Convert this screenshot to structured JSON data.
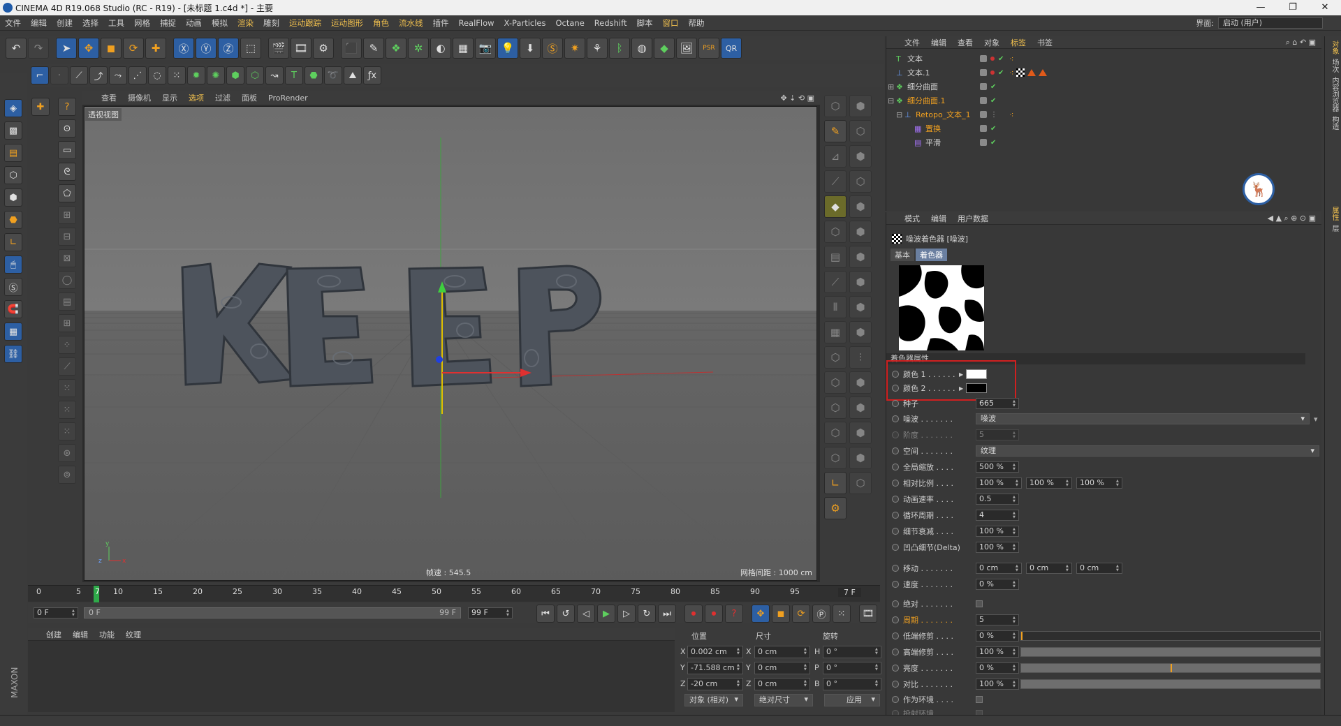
{
  "titlebar": {
    "title": "CINEMA 4D R19.068 Studio (RC - R19) - [未标题 1.c4d *] - 主要",
    "minimize": "—",
    "maximize": "❐",
    "close": "✕"
  },
  "menubar": {
    "items": [
      "文件",
      "编辑",
      "创建",
      "选择",
      "工具",
      "网格",
      "捕捉",
      "动画",
      "模拟",
      "渲染",
      "雕刻",
      "运动跟踪",
      "运动图形",
      "角色",
      "流水线",
      "插件",
      "RealFlow",
      "X-Particles",
      "Octane",
      "Redshift",
      "脚本",
      "窗口",
      "帮助"
    ],
    "layout_label": "界面:",
    "layout_value": "启动 (用户)"
  },
  "viewport": {
    "menu": [
      "查看",
      "摄像机",
      "显示",
      "选项",
      "过滤",
      "面板",
      "ProRender"
    ],
    "label": "透视视图",
    "fps": "帧速 : 545.5",
    "grid": "网格间距 : 1000 cm",
    "scene_text": "KEEP"
  },
  "timeline": {
    "ticks": [
      "0",
      "5",
      "7",
      "10",
      "15",
      "20",
      "25",
      "30",
      "35",
      "40",
      "45",
      "50",
      "55",
      "60",
      "65",
      "70",
      "75",
      "80",
      "85",
      "90",
      "95"
    ],
    "current_frame": "7 F",
    "start": "0 F",
    "range_start": "0 F",
    "range_end": "99 F",
    "end": "99 F"
  },
  "material_manager": {
    "menu": [
      "创建",
      "编辑",
      "功能",
      "纹理"
    ]
  },
  "coords": {
    "headers": [
      "位置",
      "尺寸",
      "旋转"
    ],
    "x_pos": "0.002 cm",
    "y_pos": "-71.588 cm",
    "z_pos": "-20 cm",
    "x_size": "0 cm",
    "y_size": "0 cm",
    "z_size": "0 cm",
    "h_rot": "0 °",
    "p_rot": "0 °",
    "b_rot": "0 °",
    "axis_x": "X",
    "axis_y": "Y",
    "axis_z": "Z",
    "axis_h": "H",
    "axis_p": "P",
    "axis_b": "B",
    "mode_obj": "对象 (相对)",
    "mode_size": "绝对尺寸",
    "apply": "应用"
  },
  "object_manager": {
    "menu": [
      "文件",
      "编辑",
      "查看",
      "对象",
      "标签",
      "书签"
    ],
    "objects": [
      {
        "name": "文本",
        "color": "#d0d0d0"
      },
      {
        "name": "文本.1",
        "color": "#d0d0d0"
      },
      {
        "name": "细分曲面",
        "color": "#d0d0d0"
      },
      {
        "name": "细分曲面.1",
        "color": "#f0a020"
      },
      {
        "name": "Retopo_文本_1",
        "color": "#f0a020"
      },
      {
        "name": "置换",
        "color": "#f0a020"
      },
      {
        "name": "平滑",
        "color": "#d0d0d0"
      }
    ]
  },
  "attribute_manager": {
    "menu": [
      "模式",
      "编辑",
      "用户数据"
    ],
    "title": "噪波着色器 [噪波]",
    "tabs": [
      "基本",
      "着色器"
    ],
    "section": "着色器属性",
    "color1": "颜色 1 . . . . . .",
    "color2": "颜色 2 . . . . . .",
    "color1_hex": "#ffffff",
    "color2_hex": "#000000",
    "seed_label": "种子",
    "seed": "665",
    "noise_label": "噪波 . . . . . . .",
    "noise": "噪波",
    "octave_label": "阶度 . . . . . . .",
    "octave": "5",
    "space_label": "空间 . . . . . . .",
    "space": "纹理",
    "gscale_label": "全局缩放 . . . .",
    "gscale": "500 %",
    "rscale_label": "相对比例 . . . .",
    "rscale1": "100 %",
    "rscale2": "100 %",
    "rscale3": "100 %",
    "anim_label": "动画速率 . . . .",
    "anim": "0.5",
    "loop_label": "循环周期 . . . .",
    "loop": "4",
    "detail_label": "细节衰减 . . . .",
    "detail": "100 %",
    "delta_label": "凹凸细节(Delta)",
    "delta": "100 %",
    "move_label": "移动 . . . . . . .",
    "move1": "0 cm",
    "move2": "0 cm",
    "move3": "0 cm",
    "speed_label": "速度 . . . . . . .",
    "speed": "0 %",
    "abs_label": "绝对 . . . . . . .",
    "period_label": "周期 . . . . . . .",
    "period": "5",
    "low_label": "低端修剪 . . . .",
    "low": "0 %",
    "high_label": "高端修剪 . . . .",
    "high": "100 %",
    "bright_label": "亮度 . . . . . . .",
    "bright": "0 %",
    "contrast_label": "对比 . . . . . . .",
    "contrast": "100 %",
    "env_label": "作为环境 . . . .",
    "proj_label": "投射环境 . . . ."
  },
  "right_strip": {
    "tabs": [
      "对象",
      "场次",
      "内容浏览器",
      "构造",
      "属性",
      "层"
    ]
  }
}
